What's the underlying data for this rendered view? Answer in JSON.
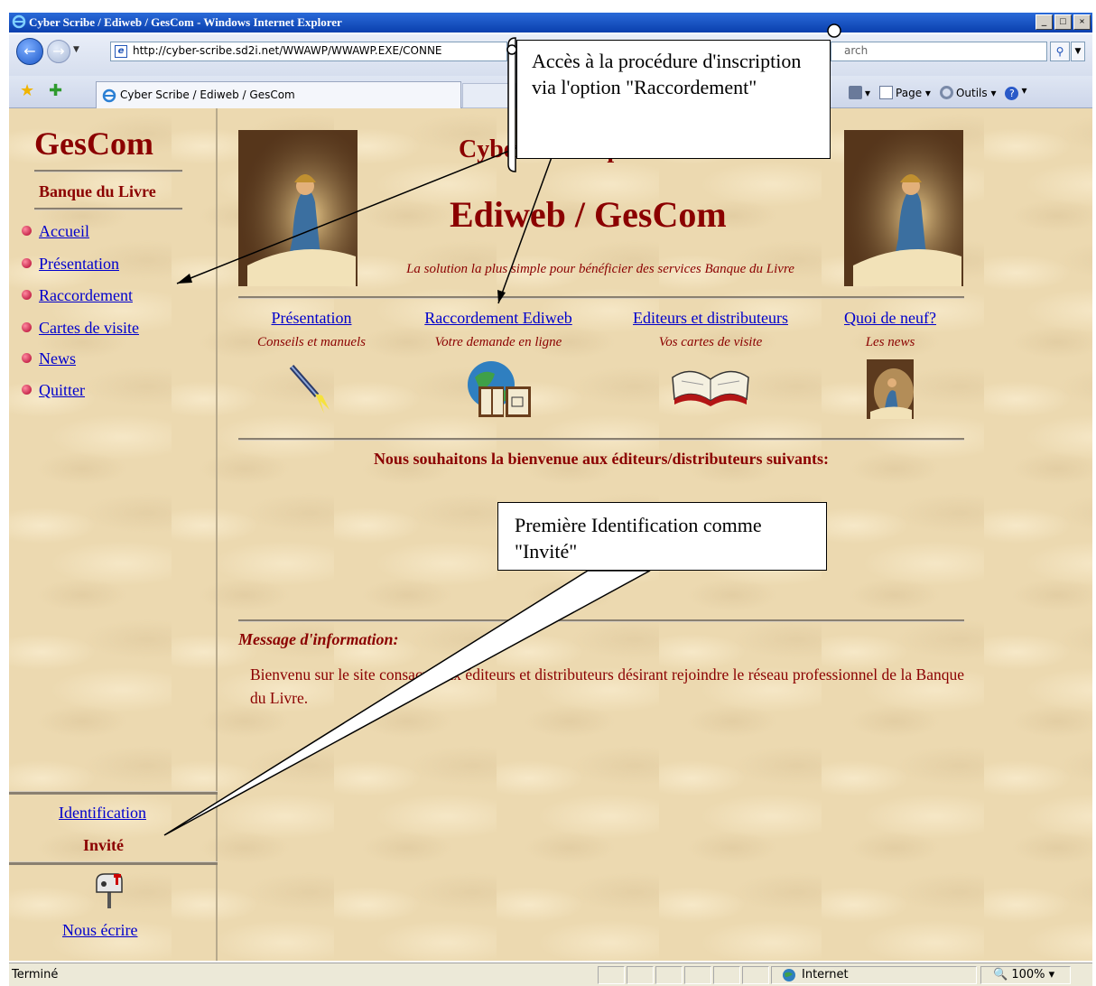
{
  "window": {
    "title": "Cyber Scribe / Ediweb / GesCom - Windows Internet Explorer",
    "url": "http://cyber-scribe.sd2i.net/WWAWP/WWAWP.EXE/CONNE",
    "search_placeholder": "arch",
    "tab_title": "Cyber Scribe / Ediweb / GesCom",
    "page_cmd": "Page",
    "tools_cmd": "Outils"
  },
  "sidebar": {
    "app_title": "GesCom",
    "subtitle": "Banque du Livre",
    "items": [
      {
        "label": "Accueil"
      },
      {
        "label": "Présentation"
      },
      {
        "label": "Raccordement"
      },
      {
        "label": "Cartes de visite"
      },
      {
        "label": "News"
      },
      {
        "label": "Quitter"
      }
    ],
    "identification_link": "Identification",
    "user_status": "Invité",
    "write_link": "Nous écrire"
  },
  "main": {
    "heading": "Cyber Scribe présente",
    "title": "Ediweb / GesCom",
    "tagline": "La solution la plus simple pour bénéficier des services Banque du Livre",
    "columns": [
      {
        "link": "Présentation",
        "subtitle": "Conseils et manuels",
        "icon": "torch-icon"
      },
      {
        "link": "Raccordement Ediweb",
        "subtitle": "Votre demande en ligne",
        "icon": "globe-book-icon"
      },
      {
        "link": "Editeurs et distributeurs",
        "subtitle": "Vos cartes de visite",
        "icon": "open-book-icon"
      },
      {
        "link": "Quoi de neuf?",
        "subtitle": "Les news",
        "icon": "scribe-thumbnail-icon"
      }
    ],
    "welcome_text": "Nous souhaitons la bienvenue aux éditeurs/distributeurs suivants:",
    "message_heading": "Message d'information:",
    "message_text": "Bienvenu sur le site consacré aux éditeurs et distributeurs désirant rejoindre le réseau professionnel de la Banque du Livre."
  },
  "status_bar": {
    "status": "Terminé",
    "zone": "Internet",
    "zoom": "100%"
  },
  "callouts": {
    "raccordement_note": "Accès à la procédure d'inscription via l'option \"Raccordement\"",
    "identification_note": "Première Identification comme \"Invité\""
  },
  "colors": {
    "brand_red": "#8b0000",
    "link_blue": "#0000cc",
    "parchment": "#ecd9b0",
    "titlebar_blue": "#0a3fae"
  }
}
